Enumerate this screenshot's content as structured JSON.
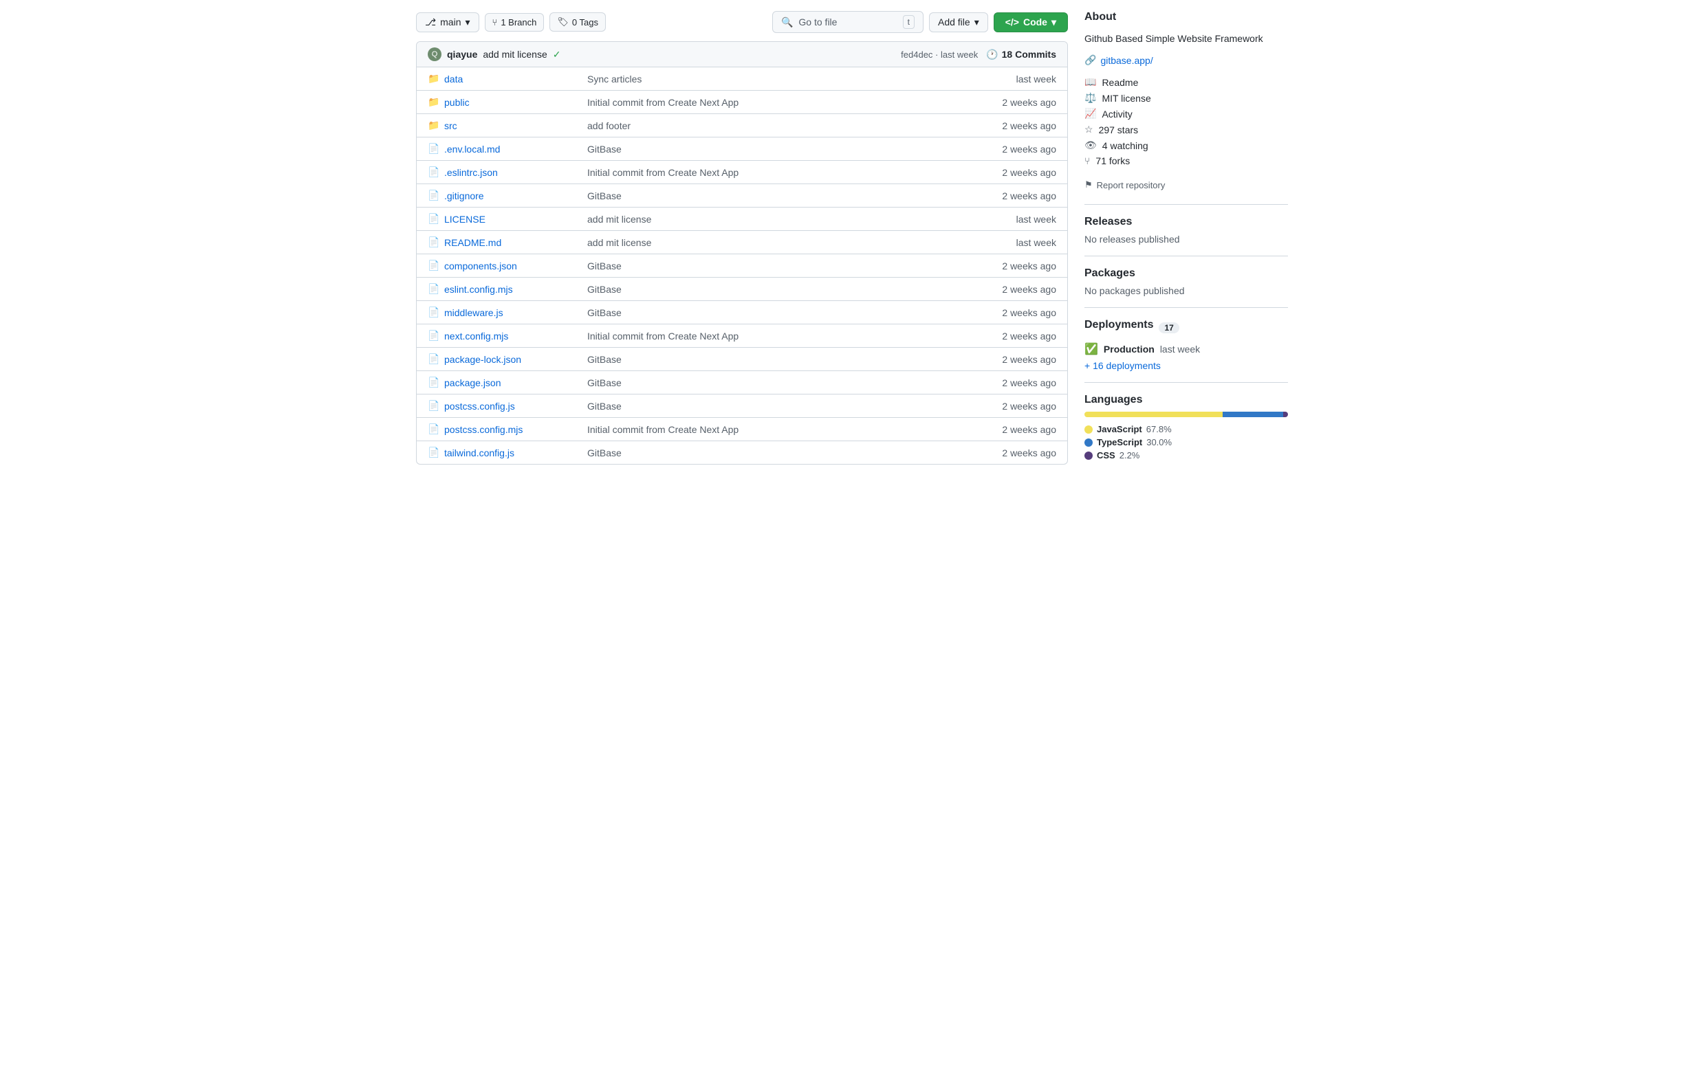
{
  "toolbar": {
    "branch_label": "main",
    "branch_icon": "⎇",
    "chevron": "▾",
    "branch_count_icon": "⑂",
    "branch_count": "1 Branch",
    "tag_icon": "🏷",
    "tag_count": "0 Tags",
    "search_placeholder": "Go to file",
    "search_shortcut": "t",
    "add_file_label": "Add file",
    "code_label": "Code"
  },
  "commit_bar": {
    "avatar_text": "Q",
    "user": "qiayue",
    "message": "add mit license",
    "check": "✓",
    "hash": "fed4dec",
    "time": "last week",
    "commits_icon": "↺",
    "commits_count": "18 Commits"
  },
  "files": [
    {
      "type": "folder",
      "name": "data",
      "commit": "Sync articles",
      "time": "last week"
    },
    {
      "type": "folder",
      "name": "public",
      "commit": "Initial commit from Create Next App",
      "time": "2 weeks ago"
    },
    {
      "type": "folder",
      "name": "src",
      "commit": "add footer",
      "time": "2 weeks ago"
    },
    {
      "type": "file",
      "name": ".env.local.md",
      "commit": "GitBase",
      "time": "2 weeks ago"
    },
    {
      "type": "file",
      "name": ".eslintrc.json",
      "commit": "Initial commit from Create Next App",
      "time": "2 weeks ago"
    },
    {
      "type": "file",
      "name": ".gitignore",
      "commit": "GitBase",
      "time": "2 weeks ago"
    },
    {
      "type": "file",
      "name": "LICENSE",
      "commit": "add mit license",
      "time": "last week"
    },
    {
      "type": "file",
      "name": "README.md",
      "commit": "add mit license",
      "time": "last week"
    },
    {
      "type": "file",
      "name": "components.json",
      "commit": "GitBase",
      "time": "2 weeks ago"
    },
    {
      "type": "file",
      "name": "eslint.config.mjs",
      "commit": "GitBase",
      "time": "2 weeks ago"
    },
    {
      "type": "file",
      "name": "middleware.js",
      "commit": "GitBase",
      "time": "2 weeks ago"
    },
    {
      "type": "file",
      "name": "next.config.mjs",
      "commit": "Initial commit from Create Next App",
      "time": "2 weeks ago"
    },
    {
      "type": "file",
      "name": "package-lock.json",
      "commit": "GitBase",
      "time": "2 weeks ago"
    },
    {
      "type": "file",
      "name": "package.json",
      "commit": "GitBase",
      "time": "2 weeks ago"
    },
    {
      "type": "file",
      "name": "postcss.config.js",
      "commit": "GitBase",
      "time": "2 weeks ago"
    },
    {
      "type": "file",
      "name": "postcss.config.mjs",
      "commit": "Initial commit from Create Next App",
      "time": "2 weeks ago"
    },
    {
      "type": "file",
      "name": "tailwind.config.js",
      "commit": "GitBase",
      "time": "2 weeks ago"
    }
  ],
  "sidebar": {
    "about_title": "About",
    "about_desc": "Github Based Simple Website Framework",
    "about_link": "gitbase.app/",
    "readme_label": "Readme",
    "license_label": "MIT license",
    "activity_label": "Activity",
    "stars_label": "297 stars",
    "watching_label": "4 watching",
    "forks_label": "71 forks",
    "report_label": "Report repository",
    "releases_title": "Releases",
    "releases_empty": "No releases published",
    "packages_title": "Packages",
    "packages_empty": "No packages published",
    "deployments_title": "Deployments",
    "deployments_count": "17",
    "deployment_env": "Production",
    "deployment_time": "last week",
    "deployments_more": "+ 16 deployments",
    "languages_title": "Languages",
    "languages": [
      {
        "name": "JavaScript",
        "pct": "67.8%",
        "color": "#f1e05a",
        "bar_width": 67.8
      },
      {
        "name": "TypeScript",
        "pct": "30.0%",
        "color": "#3178c6",
        "bar_width": 30.0
      },
      {
        "name": "CSS",
        "pct": "2.2%",
        "color": "#563d7c",
        "bar_width": 2.2
      }
    ]
  }
}
